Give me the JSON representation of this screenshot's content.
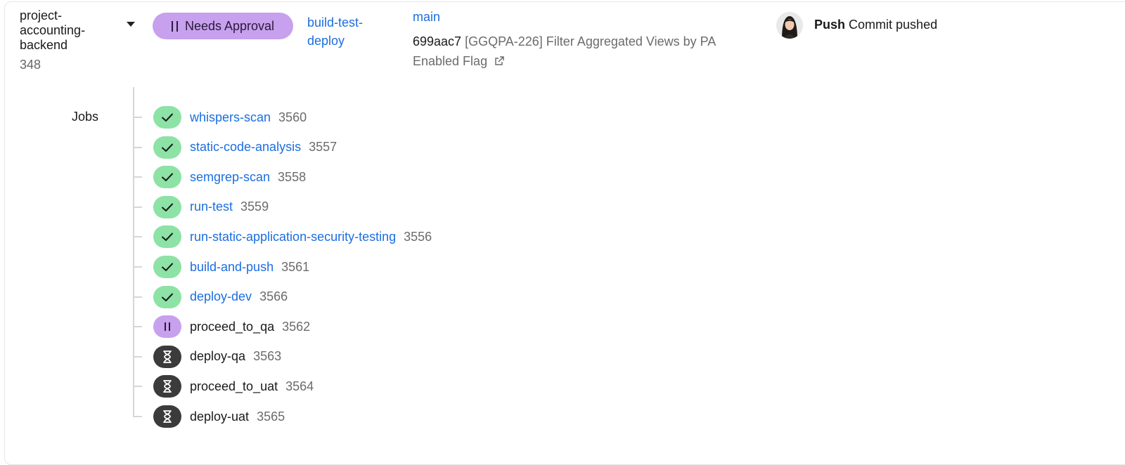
{
  "pipeline": {
    "project_name": "project-accounting-backend",
    "project_number": "348",
    "status": "Needs Approval",
    "workflow": "build-test-deploy",
    "branch": "main",
    "commit_sha": "699aac7",
    "commit_message": "[GGQPA-226] Filter Aggregated Views by PA Enabled Flag",
    "trigger_type": "Push",
    "trigger_text": "Commit pushed"
  },
  "jobs_label": "Jobs",
  "jobs": [
    {
      "name": "whispers-scan",
      "id": "3560",
      "status": "success"
    },
    {
      "name": "static-code-analysis",
      "id": "3557",
      "status": "success"
    },
    {
      "name": "semgrep-scan",
      "id": "3558",
      "status": "success"
    },
    {
      "name": "run-test",
      "id": "3559",
      "status": "success"
    },
    {
      "name": "run-static-application-security-testing",
      "id": "3556",
      "status": "success"
    },
    {
      "name": "build-and-push",
      "id": "3561",
      "status": "success"
    },
    {
      "name": "deploy-dev",
      "id": "3566",
      "status": "success"
    },
    {
      "name": "proceed_to_qa",
      "id": "3562",
      "status": "on-hold"
    },
    {
      "name": "deploy-qa",
      "id": "3563",
      "status": "blocked"
    },
    {
      "name": "proceed_to_uat",
      "id": "3564",
      "status": "blocked"
    },
    {
      "name": "deploy-uat",
      "id": "3565",
      "status": "blocked"
    }
  ],
  "colors": {
    "link": "#1c6ee0",
    "success": "#8de2a6",
    "on_hold": "#c7a0ee",
    "blocked": "#3b3b3b"
  },
  "icons": {
    "success": "check-icon",
    "on-hold": "pause-icon",
    "blocked": "hourglass-icon",
    "commit_link": "external-link-icon",
    "project_menu": "chevron-down-icon"
  }
}
